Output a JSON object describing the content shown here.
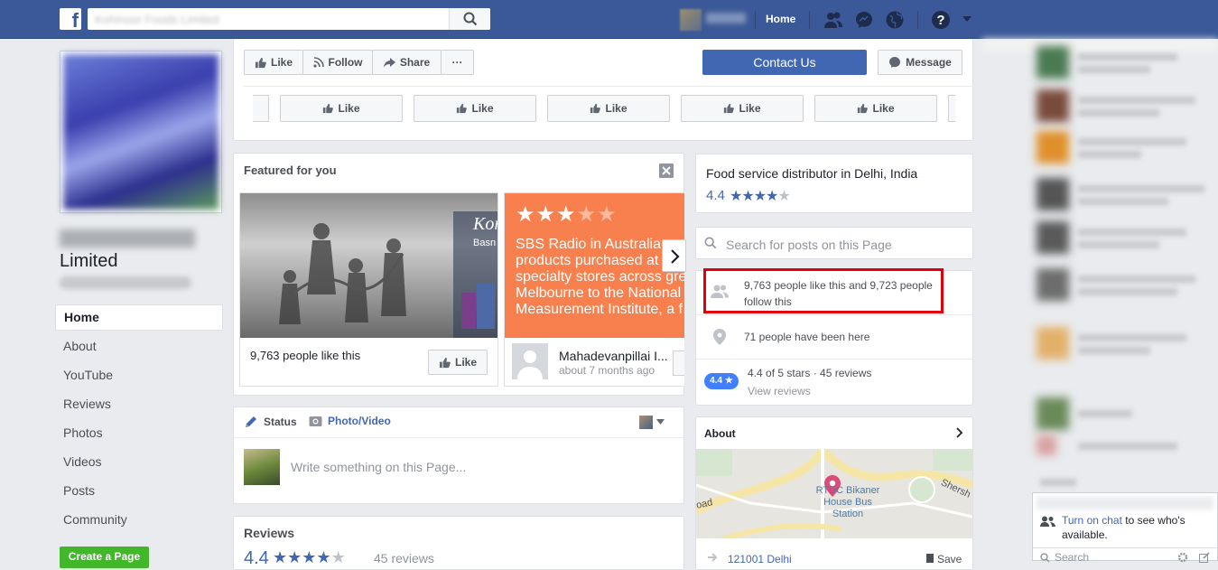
{
  "topbar": {
    "logo": "f",
    "search_placeholder": "Kohinoor Foods Limited",
    "home": "Home",
    "icons": [
      "search-icon",
      "friend-requests-icon",
      "messenger-icon",
      "globe-icon",
      "help-icon",
      "dropdown-caret-icon"
    ]
  },
  "left": {
    "page_name": "Limited",
    "nav": [
      "Home",
      "About",
      "YouTube",
      "Reviews",
      "Photos",
      "Videos",
      "Posts",
      "Community"
    ],
    "create_page": "Create a Page"
  },
  "actions": {
    "like": "Like",
    "follow": "Follow",
    "share": "Share",
    "more": "···",
    "contact": "Contact Us",
    "message": "Message"
  },
  "like_strip": [
    "Like",
    "Like",
    "Like",
    "Like",
    "Like"
  ],
  "featured": {
    "title": "Featured for you",
    "card1": {
      "likes": "9,763 people like this",
      "button": "Like"
    },
    "card2": {
      "stars": 3,
      "text": "SBS Radio in Australia products purchased at specialty stores across gre Melbourne to the National Measurement Institute, a f",
      "author": "Mahadevanpillai I...",
      "time": "about 7 months ago"
    }
  },
  "composer": {
    "status": "Status",
    "photo_video": "Photo/Video",
    "placeholder": "Write something on this Page..."
  },
  "reviews_card": {
    "title": "Reviews",
    "rating": "4.4",
    "count": "45 reviews"
  },
  "info": {
    "category": "Food service distributor in Delhi, India",
    "rating": "4.4",
    "rating_value": 4.4,
    "search_placeholder": "Search for posts on this Page",
    "likes_follows": "9,763 people like this and 9,723 people follow this",
    "checkins": "71 people have been here",
    "rating_badge": "4.4 ★",
    "rating_text": "4.4 of 5 stars · 45 reviews",
    "view_reviews": "View reviews",
    "about": "About",
    "map_labels": {
      "main": "RTDC Bikaner House Bus Station",
      "road": "oad",
      "road2": "Shersh"
    },
    "address": "121001 Delhi",
    "save": "Save"
  },
  "chat": {
    "turn_on": "Turn on chat",
    "rest": "to see who's available.",
    "search": "Search"
  },
  "colors": {
    "fb_blue": "#3b5998",
    "button_blue": "#4267b2",
    "orange": "#f7804e",
    "highlight_red": "#e0000b",
    "green": "#42b72a"
  }
}
